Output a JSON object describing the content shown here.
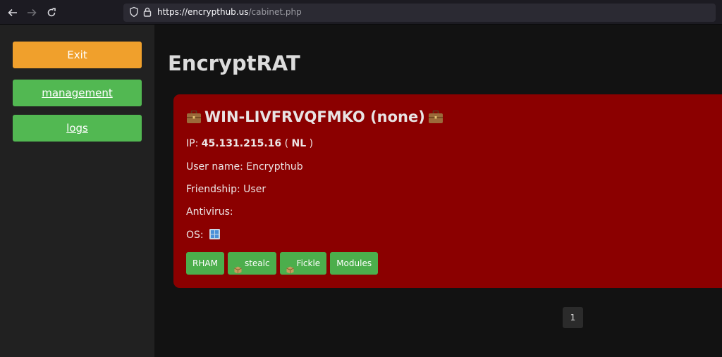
{
  "browser": {
    "url_host": "https://encrypthub.us",
    "url_path": "/cabinet.php",
    "icons": [
      "back-arrow-icon",
      "forward-arrow-icon",
      "reload-icon",
      "shield-icon",
      "lock-icon"
    ]
  },
  "sidebar": {
    "exit_label": "Exit",
    "management_label": "management",
    "logs_label": "logs"
  },
  "main": {
    "title": "EncryptRAT",
    "card": {
      "hostname": "WIN-LIVFRVQFMKO (none)",
      "ip_label": "IP:",
      "ip_value": "45.131.215.16",
      "country_open": "(",
      "country": "NL",
      "country_close": ")",
      "user_name": "User name: Encrypthub",
      "friendship": "Friendship: User",
      "antivirus": "Antivirus:",
      "os_label": "OS:",
      "buttons": {
        "rham": "RHAM",
        "stealc": "stealc",
        "fickle": "Fickle",
        "modules": "Modules"
      }
    },
    "pagination": {
      "current_page": "1"
    }
  },
  "colors": {
    "exit": "#f0a02c",
    "sidebar_green": "#52b852",
    "card_background": "#8b0000",
    "action_green": "#4cae4c"
  }
}
